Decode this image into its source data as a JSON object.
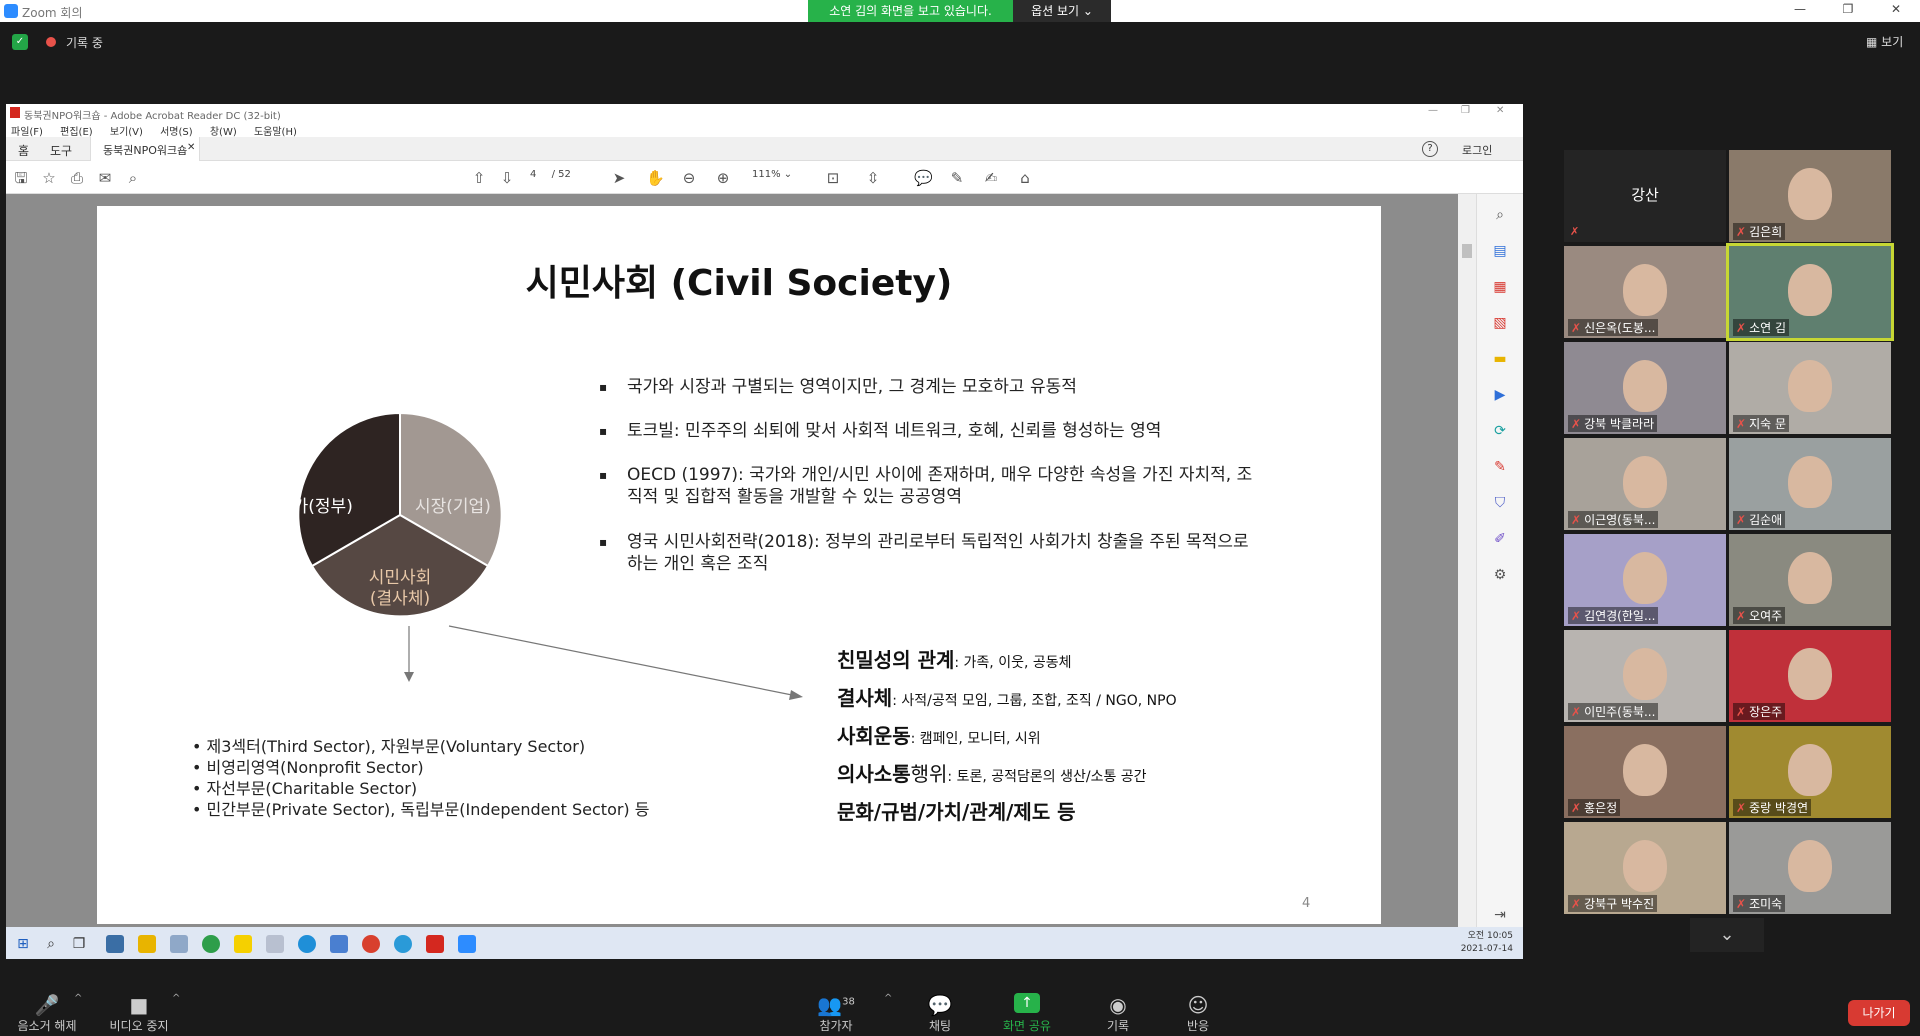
{
  "zoom": {
    "window_title": "Zoom 회의",
    "share_banner": "소연 김의 화면을 보고 있습니다.",
    "view_options": "옵션 보기 ⌄",
    "recording_label": "기록 중",
    "view_button": "보기"
  },
  "acrobat": {
    "window_title": "동북권NPO워크숍 - Adobe Acrobat Reader DC (32-bit)",
    "menu": [
      "파일(F)",
      "편집(E)",
      "보기(V)",
      "서명(S)",
      "창(W)",
      "도움말(H)"
    ],
    "tabs": [
      "홈",
      "도구"
    ],
    "doc_tab": "동북권NPO워크숍",
    "login": "로그인",
    "page_current": "4",
    "page_total": "/ 52",
    "zoom_level": "111%"
  },
  "slide": {
    "title": "시민사회 (Civil Society)",
    "pie_labels": {
      "state": "국가(정부)",
      "market": "시장(기업)",
      "civil": "시민사회",
      "civil_sub": "(결사체)"
    },
    "bullets": [
      "국가와 시장과 구별되는 영역이지만, 그 경계는 모호하고 유동적",
      "토크빌: 민주주의 쇠퇴에 맞서 사회적 네트워크, 호혜, 신뢰를 형성하는 영역",
      "OECD (1997): 국가와 개인/시민 사이에 존재하며, 매우 다양한 속성을 가진 자치적, 조직적 및 집합적 활동을 개발할 수 있는 공공영역",
      "영국 시민사회전략(2018): 정부의 관리로부터 독립적인 사회가치 창출을 주된 목적으로 하는 개인 혹은 조직"
    ],
    "relations": [
      {
        "head": "친밀성의 관계",
        "sub": ": 가족, 이웃, 공동체"
      },
      {
        "head": "결사체",
        "sub": ": 사적/공적 모임, 그룹, 조합, 조직 / NGO, NPO"
      },
      {
        "head": "사회운동",
        "sub": ": 캠페인, 모니터, 시위"
      },
      {
        "head": "의사소통",
        "headsub": "행위",
        "sub": ": 토론, 공적담론의 생산/소통 공간"
      },
      {
        "head": "문화/규범/가치/관계/제도 등",
        "sub": ""
      }
    ],
    "sectors": [
      "제3섹터(Third Sector), 자원부문(Voluntary Sector)",
      "비영리영역(Nonprofit Sector)",
      "자선부문(Charitable Sector)",
      "민간부문(Private Sector), 독립부문(Independent Sector) 등"
    ],
    "page_number": "4"
  },
  "taskbar": {
    "time": "오전 10:05",
    "date": "2021-07-14"
  },
  "participants": [
    {
      "name": "강산",
      "type": "text"
    },
    {
      "name": "김은희",
      "color": "#8a7a6a"
    },
    {
      "name": "신은옥(도봉...",
      "color": "#9a8a80"
    },
    {
      "name": "소연 김",
      "color": "#5f7f6f",
      "active": true
    },
    {
      "name": "강북 박클라라",
      "color": "#8f8a92"
    },
    {
      "name": "지숙 문",
      "color": "#b0aca6"
    },
    {
      "name": "이근영(동북...",
      "color": "#a8a29a"
    },
    {
      "name": "김순애",
      "color": "#9aa0a0"
    },
    {
      "name": "김연경(한일...",
      "color": "#a6a0c8"
    },
    {
      "name": "오여주",
      "color": "#8a8a80"
    },
    {
      "name": "이민주(동북...",
      "color": "#b8b4b0"
    },
    {
      "name": "장은주",
      "color": "#c0303a"
    },
    {
      "name": "홍은정",
      "color": "#8a6f60"
    },
    {
      "name": "중랑 박경연",
      "color": "#a08a30"
    },
    {
      "name": "강북구 박수진",
      "color": "#b8a890"
    },
    {
      "name": "조미숙",
      "color": "#9a9a98"
    }
  ],
  "controls": {
    "mute": "음소거 해제",
    "video": "비디오 중지",
    "participants": "참가자",
    "participant_count": "38",
    "chat": "채팅",
    "share": "화면 공유",
    "record": "기록",
    "reactions": "반응",
    "leave": "나가기"
  }
}
